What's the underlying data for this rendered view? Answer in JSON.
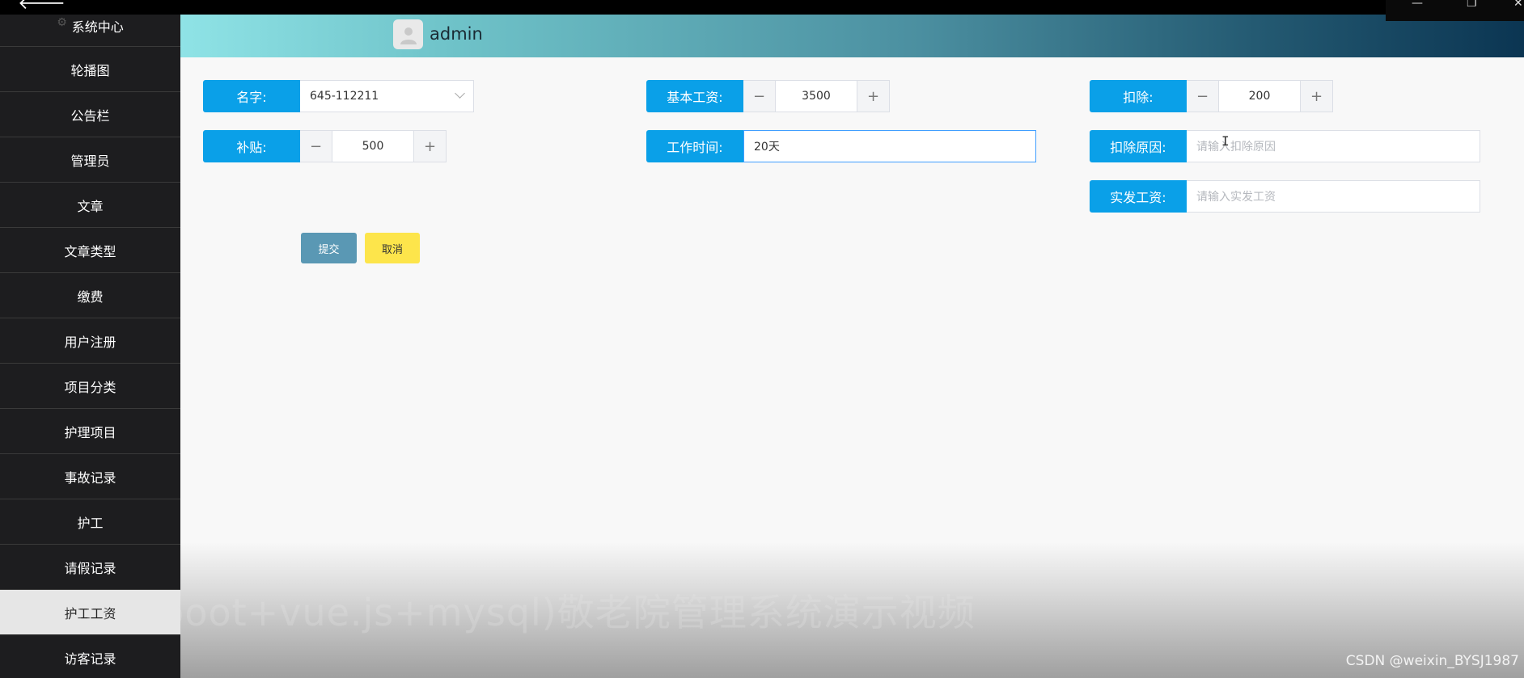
{
  "header": {
    "username": "admin"
  },
  "sidebar": {
    "items": [
      {
        "label": "系统中心"
      },
      {
        "label": "轮播图"
      },
      {
        "label": "公告栏"
      },
      {
        "label": "管理员"
      },
      {
        "label": "文章"
      },
      {
        "label": "文章类型"
      },
      {
        "label": "缴费"
      },
      {
        "label": "用户注册"
      },
      {
        "label": "项目分类"
      },
      {
        "label": "护理项目"
      },
      {
        "label": "事故记录"
      },
      {
        "label": "护工"
      },
      {
        "label": "请假记录"
      },
      {
        "label": "护工工资"
      },
      {
        "label": "访客记录"
      }
    ],
    "active_index": 13
  },
  "form": {
    "name": {
      "label": "名字:",
      "value": "645-112211"
    },
    "base_salary": {
      "label": "基本工资:",
      "value": "3500",
      "minus": "−",
      "plus": "+"
    },
    "deduction": {
      "label": "扣除:",
      "value": "200",
      "minus": "−",
      "plus": "+"
    },
    "subsidy": {
      "label": "补贴:",
      "value": "500",
      "minus": "−",
      "plus": "+"
    },
    "work_time": {
      "label": "工作时间:",
      "value": "20天"
    },
    "deduction_reason": {
      "label": "扣除原因:",
      "placeholder": "请输入扣除原因"
    },
    "actual_salary": {
      "label": "实发工资:",
      "placeholder": "请输入实发工资"
    }
  },
  "actions": {
    "submit": "提交",
    "cancel": "取消"
  },
  "watermarks": {
    "title": "(springboot+vue.js+mysql)敬老院管理系统演示视频",
    "csdn": "CSDN @weixin_BYSJ1987"
  }
}
